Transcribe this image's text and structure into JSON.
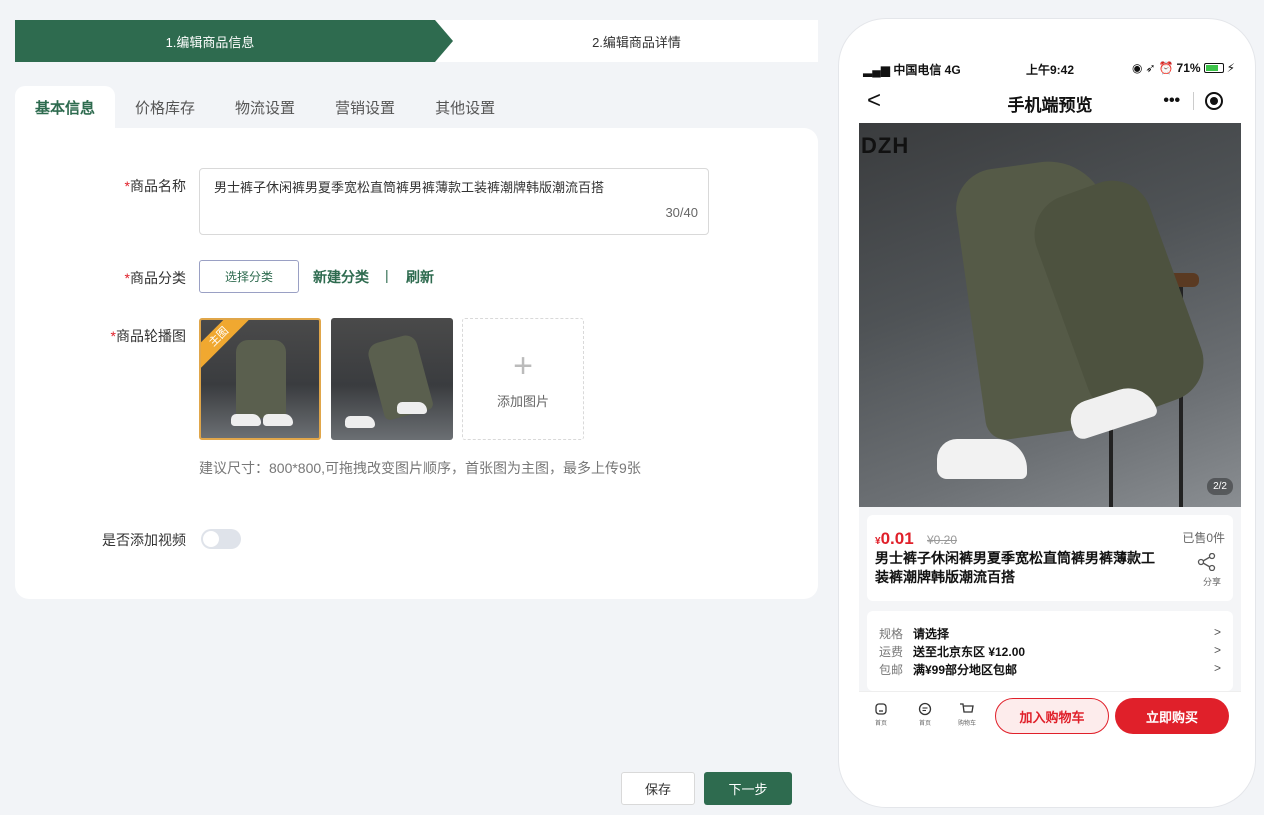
{
  "steps": {
    "step1": "1.编辑商品信息",
    "step2": "2.编辑商品详情"
  },
  "tabs": [
    {
      "label": "基本信息",
      "active": true
    },
    {
      "label": "价格库存"
    },
    {
      "label": "物流设置"
    },
    {
      "label": "营销设置"
    },
    {
      "label": "其他设置"
    }
  ],
  "form": {
    "required_mark": "*",
    "name_label": "商品名称",
    "name_value": "男士裤子休闲裤男夏季宽松直筒裤男裤薄款工装裤潮牌韩版潮流百搭",
    "name_count": "30/40",
    "category_label": "商品分类",
    "category_button": "选择分类",
    "new_category": "新建分类",
    "separator": "|",
    "refresh": "刷新",
    "carousel_label": "商品轮播图",
    "main_badge": "主图",
    "add_image": "添加图片",
    "add_plus": "+",
    "hint": "建议尺寸：800*800,可拖拽改变图片顺序，首张图为主图，最多上传9张",
    "video_label": "是否添加视频"
  },
  "buttons": {
    "save": "保存",
    "next": "下一步"
  },
  "phone": {
    "status": {
      "carrier": "中国电信",
      "network": "4G",
      "time": "上午9:42",
      "battery": "71%"
    },
    "nav": {
      "back": "<",
      "title": "手机端预览",
      "more": "•••"
    },
    "hero": {
      "logo": "DZH",
      "counter": "2/2"
    },
    "product": {
      "price_symbol": "¥",
      "price": "0.01",
      "old_price": "¥0.20",
      "sold": "已售0件",
      "title": "男士裤子休闲裤男夏季宽松直筒裤男裤薄款工装裤潮牌韩版潮流百搭",
      "share": "分享"
    },
    "specs": [
      {
        "key": "规格",
        "value": "请选择"
      },
      {
        "key": "运费",
        "value": "送至北京东区 ¥12.00"
      },
      {
        "key": "包邮",
        "value": "满¥99部分地区包邮"
      }
    ],
    "chevron": ">",
    "bottom": {
      "home": "首页",
      "service": "首页",
      "cart": "购物车",
      "add_cart": "加入购物车",
      "buy": "立即购买"
    }
  },
  "colors": {
    "primary": "#2e6b4f",
    "danger": "#e0202a",
    "badge": "#f0a830"
  }
}
